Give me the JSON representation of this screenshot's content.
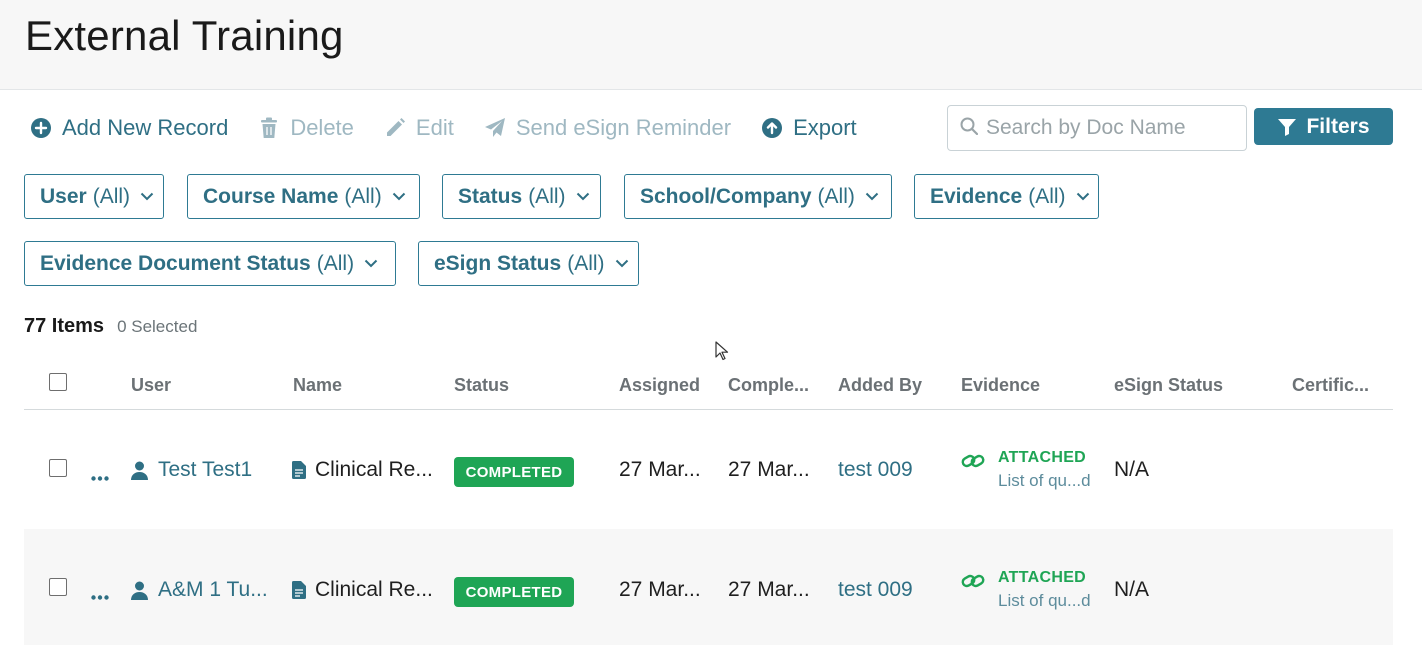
{
  "page": {
    "title": "External Training"
  },
  "toolbar": {
    "add": "Add New Record",
    "delete": "Delete",
    "edit": "Edit",
    "send_reminder": "Send eSign Reminder",
    "export": "Export"
  },
  "search": {
    "placeholder": "Search by Doc Name"
  },
  "filters_button": "Filters",
  "filter_chips": {
    "user": {
      "label": "User",
      "value": "(All)"
    },
    "course": {
      "label": "Course Name",
      "value": "(All)"
    },
    "status": {
      "label": "Status",
      "value": "(All)"
    },
    "school": {
      "label": "School/Company",
      "value": "(All)"
    },
    "evidence": {
      "label": "Evidence",
      "value": "(All)"
    },
    "evidence_doc_status": {
      "label": "Evidence Document Status",
      "value": "(All)"
    },
    "esign_status": {
      "label": "eSign Status",
      "value": "(All)"
    }
  },
  "summary": {
    "items": "77 Items",
    "selected": "0 Selected"
  },
  "table": {
    "headers": {
      "user": "User",
      "name": "Name",
      "status": "Status",
      "assigned": "Assigned",
      "completed": "Comple...",
      "added_by": "Added By",
      "evidence": "Evidence",
      "esign_status": "eSign Status",
      "certificate": "Certific..."
    },
    "rows": [
      {
        "user": "Test Test1",
        "name": "Clinical Re...",
        "status": "COMPLETED",
        "assigned": "27 Mar...",
        "completed": "27 Mar...",
        "added_by": "test 009",
        "evidence_label": "ATTACHED",
        "evidence_file": "List of qu...d",
        "esign": "N/A"
      },
      {
        "user": "A&M 1 Tu...",
        "name": "Clinical Re...",
        "status": "COMPLETED",
        "assigned": "27 Mar...",
        "completed": "27 Mar...",
        "added_by": "test 009",
        "evidence_label": "ATTACHED",
        "evidence_file": "List of qu...d",
        "esign": "N/A"
      }
    ]
  },
  "colors": {
    "accent": "#2e7a93",
    "link": "#2f6f84",
    "disabled": "#9fb8c2",
    "success": "#1fa555"
  },
  "icons": [
    "plus-circle-icon",
    "trash-icon",
    "pencil-icon",
    "paper-plane-icon",
    "upload-circle-icon",
    "search-icon",
    "filter-icon",
    "chevron-down-icon",
    "checkbox-icon",
    "ellipsis-icon",
    "user-icon",
    "document-icon",
    "link-icon",
    "cursor-icon"
  ]
}
